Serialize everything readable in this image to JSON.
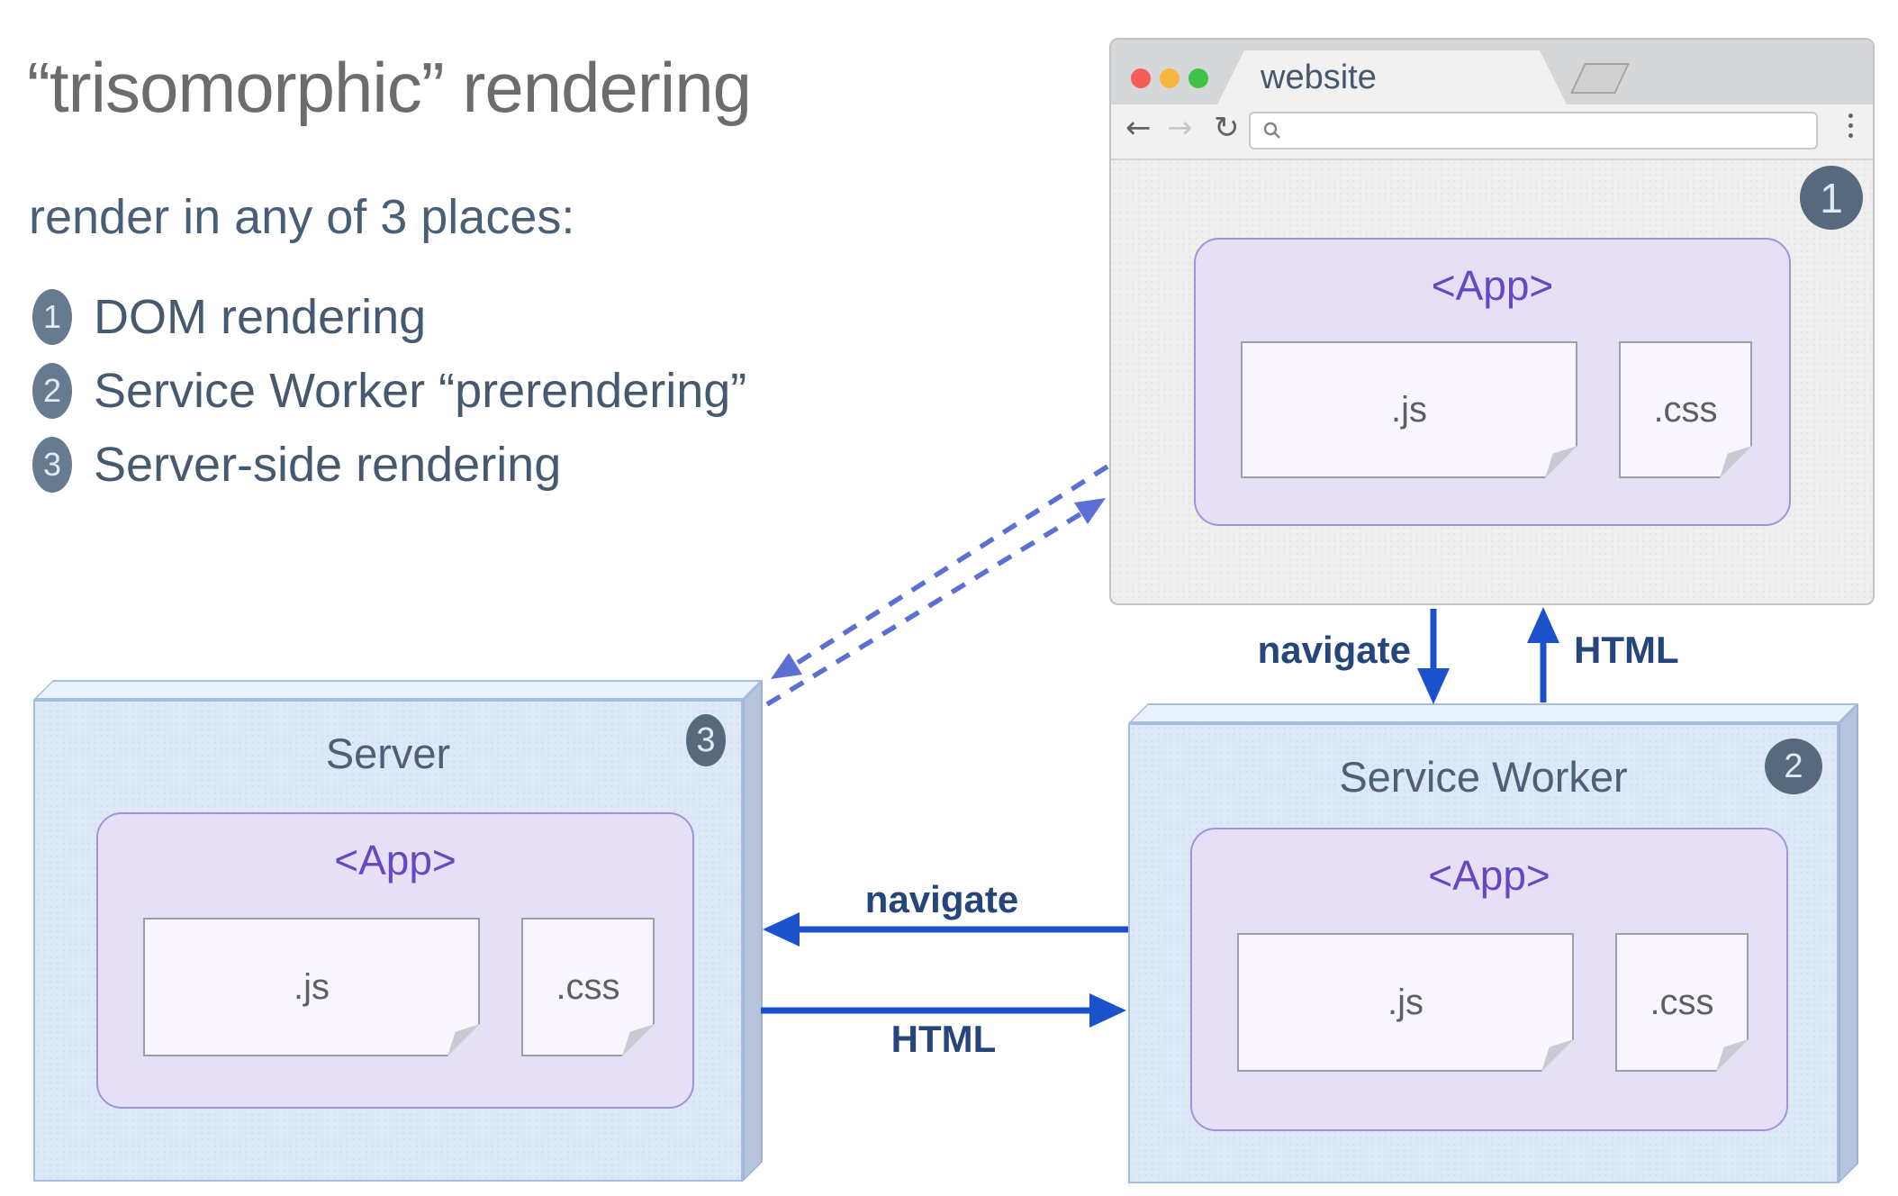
{
  "heading": {
    "title": "“trisomorphic” rendering",
    "subtitle": "render in any of 3 places:",
    "list": [
      {
        "num": "1",
        "label": "DOM rendering"
      },
      {
        "num": "2",
        "label": "Service Worker “prerendering”"
      },
      {
        "num": "3",
        "label": "Server-side rendering"
      }
    ]
  },
  "browser": {
    "tab_title": "website",
    "badge": "1",
    "app": {
      "title": "<App>",
      "js_label": ".js",
      "css_label": ".css"
    }
  },
  "server": {
    "title": "Server",
    "badge": "3",
    "app": {
      "title": "<App>",
      "js_label": ".js",
      "css_label": ".css"
    }
  },
  "service_worker": {
    "title": "Service Worker",
    "badge": "2",
    "app": {
      "title": "<App>",
      "js_label": ".js",
      "css_label": ".css"
    }
  },
  "flows": {
    "navigate_down": "navigate",
    "html_up": "HTML",
    "navigate_left": "navigate",
    "html_right": "HTML"
  },
  "colors": {
    "arrow_blue": "#1b51cb",
    "dashed_periwinkle": "#5c70d4",
    "label_navy": "#25457b",
    "badge_light": "#667a90",
    "badge_dark": "#57697c",
    "app_purple": "#6a47c2",
    "traffic_red": "#f15f58",
    "traffic_yellow": "#f5b73f",
    "traffic_green": "#3fc14a"
  }
}
